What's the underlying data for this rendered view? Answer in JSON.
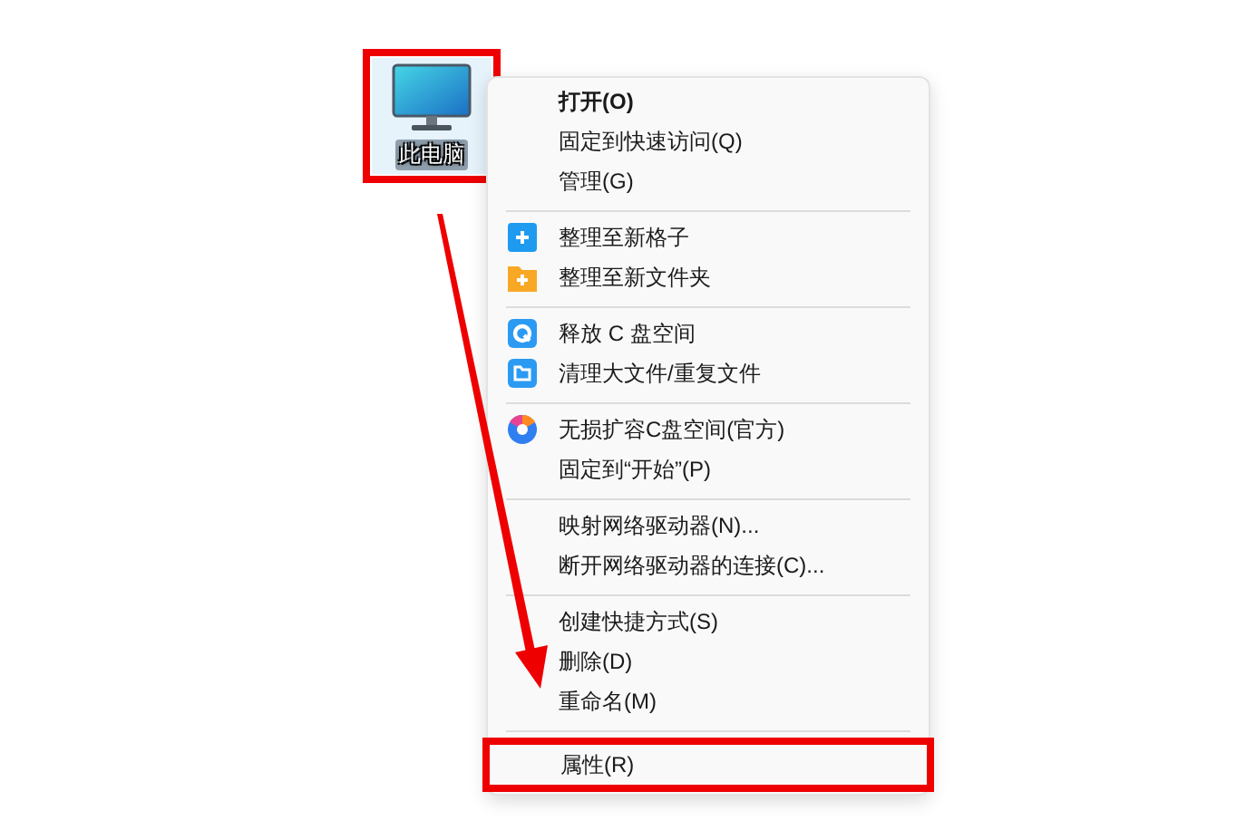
{
  "desktop_icon": {
    "label": "此电脑",
    "selected": true,
    "highlighted": true
  },
  "context_menu": {
    "sections": [
      [
        {
          "label": "打开(O)",
          "kind": "plain",
          "default": true,
          "highlighted": false
        },
        {
          "label": "固定到快速访问(Q)",
          "kind": "plain",
          "default": false,
          "highlighted": false
        },
        {
          "label": "管理(G)",
          "kind": "plain",
          "default": false,
          "highlighted": false
        }
      ],
      [
        {
          "label": "整理至新格子",
          "kind": "new-grid",
          "default": false,
          "highlighted": false
        },
        {
          "label": "整理至新文件夹",
          "kind": "new-folder",
          "default": false,
          "highlighted": false
        }
      ],
      [
        {
          "label": "释放 C 盘空间",
          "kind": "free-space",
          "default": false,
          "highlighted": false
        },
        {
          "label": "清理大文件/重复文件",
          "kind": "large-files",
          "default": false,
          "highlighted": false
        }
      ],
      [
        {
          "label": "无损扩容C盘空间(官方)",
          "kind": "expand-disk",
          "default": false,
          "highlighted": false
        },
        {
          "label": "固定到“开始”(P)",
          "kind": "plain",
          "default": false,
          "highlighted": false
        }
      ],
      [
        {
          "label": "映射网络驱动器(N)...",
          "kind": "plain",
          "default": false,
          "highlighted": false
        },
        {
          "label": "断开网络驱动器的连接(C)...",
          "kind": "plain",
          "default": false,
          "highlighted": false
        }
      ],
      [
        {
          "label": "创建快捷方式(S)",
          "kind": "plain",
          "default": false,
          "highlighted": false
        },
        {
          "label": "删除(D)",
          "kind": "plain",
          "default": false,
          "highlighted": false
        },
        {
          "label": "重命名(M)",
          "kind": "plain",
          "default": false,
          "highlighted": false
        }
      ],
      [
        {
          "label": "属性(R)",
          "kind": "plain",
          "default": false,
          "highlighted": true
        }
      ]
    ]
  },
  "arrow": true
}
